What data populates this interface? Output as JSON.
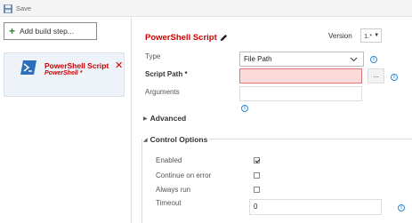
{
  "toolbar": {
    "save_label": "Save"
  },
  "left": {
    "add_step_label": "Add build step...",
    "step": {
      "title": "PowerShell Script",
      "subtitle": "PowerShell *"
    }
  },
  "task": {
    "title": "PowerShell Script",
    "version_label": "Version",
    "version_value": "1.*",
    "fields": {
      "type_label": "Type",
      "type_value": "File Path",
      "script_path_label": "Script Path *",
      "script_path_value": "",
      "browse_label": "...",
      "arguments_label": "Arguments",
      "arguments_value": ""
    },
    "advanced_label": "Advanced",
    "control_options": {
      "label": "Control Options",
      "enabled_label": "Enabled",
      "enabled": true,
      "continue_on_error_label": "Continue on error",
      "continue_on_error": false,
      "always_run_label": "Always run",
      "always_run": false,
      "timeout_label": "Timeout",
      "timeout_value": "0"
    }
  },
  "colors": {
    "accent_red": "#cc0000",
    "info_blue": "#2b86d9",
    "error_field_bg": "#fbdada",
    "powershell_blue": "#2a6fb8"
  }
}
